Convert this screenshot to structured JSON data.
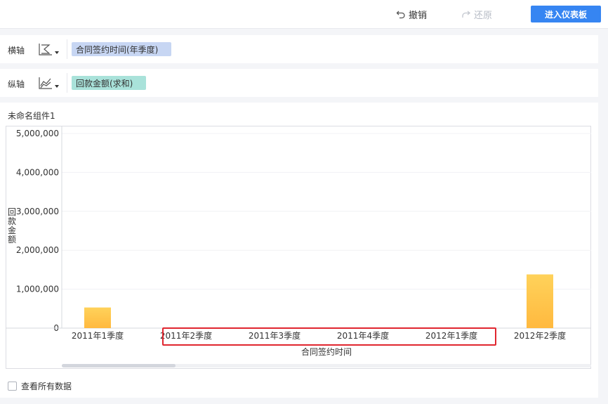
{
  "toolbar": {
    "undo_label": "撤销",
    "redo_label": "还原",
    "enter_dashboard_label": "进入仪表板"
  },
  "x_axis_row": {
    "label": "横轴",
    "field": "合同签约时间(年季度)",
    "icon": "bar-chart-type-icon"
  },
  "y_axis_row": {
    "label": "纵轴",
    "field": "回款金额(求和)",
    "icon": "line-chart-type-icon"
  },
  "widget": {
    "title": "未命名组件1",
    "show_all_data_label": "查看所有数据"
  },
  "colors": {
    "primary": "#3685f2",
    "bar_top": "#ffd25a",
    "bar_bottom": "#ffb93f",
    "x_pill": "#c7d6f3",
    "y_pill": "#a9e2da",
    "highlight": "#e0262f"
  },
  "chart_data": {
    "type": "bar",
    "categories": [
      "2011年1季度",
      "2011年2季度",
      "2011年3季度",
      "2011年4季度",
      "2012年1季度",
      "2012年2季度"
    ],
    "values": [
      530000,
      0,
      0,
      0,
      0,
      1380000
    ],
    "ylim": [
      0,
      5000000
    ],
    "yticks": [
      0,
      1000000,
      2000000,
      3000000,
      4000000,
      5000000
    ],
    "ytick_labels": [
      "0",
      "1,000,000",
      "2,000,000",
      "3,000,000",
      "4,000,000",
      "5,000,000"
    ],
    "xlabel": "合同签约时间",
    "ylabel": "回款金额",
    "grid": true
  }
}
